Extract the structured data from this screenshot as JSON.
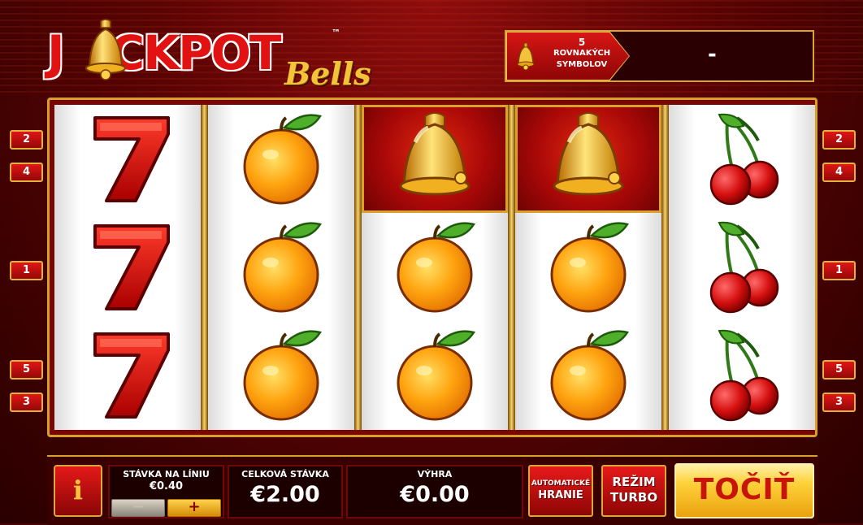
{
  "logo": {
    "main_left": "J",
    "main_right": "CKPOT",
    "sub": "Bells",
    "tm": "™"
  },
  "jackpot_info": {
    "count": "5",
    "line1": "ROVNAKÝCH",
    "line2": "SYMBOLOV",
    "value": "-"
  },
  "paylines_left": [
    "2",
    "4",
    "1",
    "5",
    "3"
  ],
  "paylines_right": [
    "2",
    "4",
    "1",
    "5",
    "3"
  ],
  "reels": [
    [
      "seven",
      "seven",
      "seven"
    ],
    [
      "orange",
      "orange",
      "orange"
    ],
    [
      "bell",
      "orange",
      "orange"
    ],
    [
      "bell",
      "orange",
      "orange"
    ],
    [
      "cherry",
      "cherry",
      "cherry"
    ]
  ],
  "controls": {
    "info": "i",
    "bet_per_line_label": "STÁVKA NA LÍNIU",
    "bet_per_line_value": "€0.40",
    "minus": "−",
    "plus": "+",
    "total_bet_label": "CELKOVÁ STÁVKA",
    "total_bet_value": "€2.00",
    "win_label": "VÝHRA",
    "win_value": "€0.00",
    "autoplay_line1": "AUTOMATICKÉ",
    "autoplay_line2": "HRANIE",
    "turbo_line1": "REŽIM",
    "turbo_line2": "TURBO",
    "spin": "TOČIŤ"
  },
  "colors": {
    "accent_gold": "#d6a02a",
    "accent_red": "#e31212",
    "background": "#5a0303"
  }
}
